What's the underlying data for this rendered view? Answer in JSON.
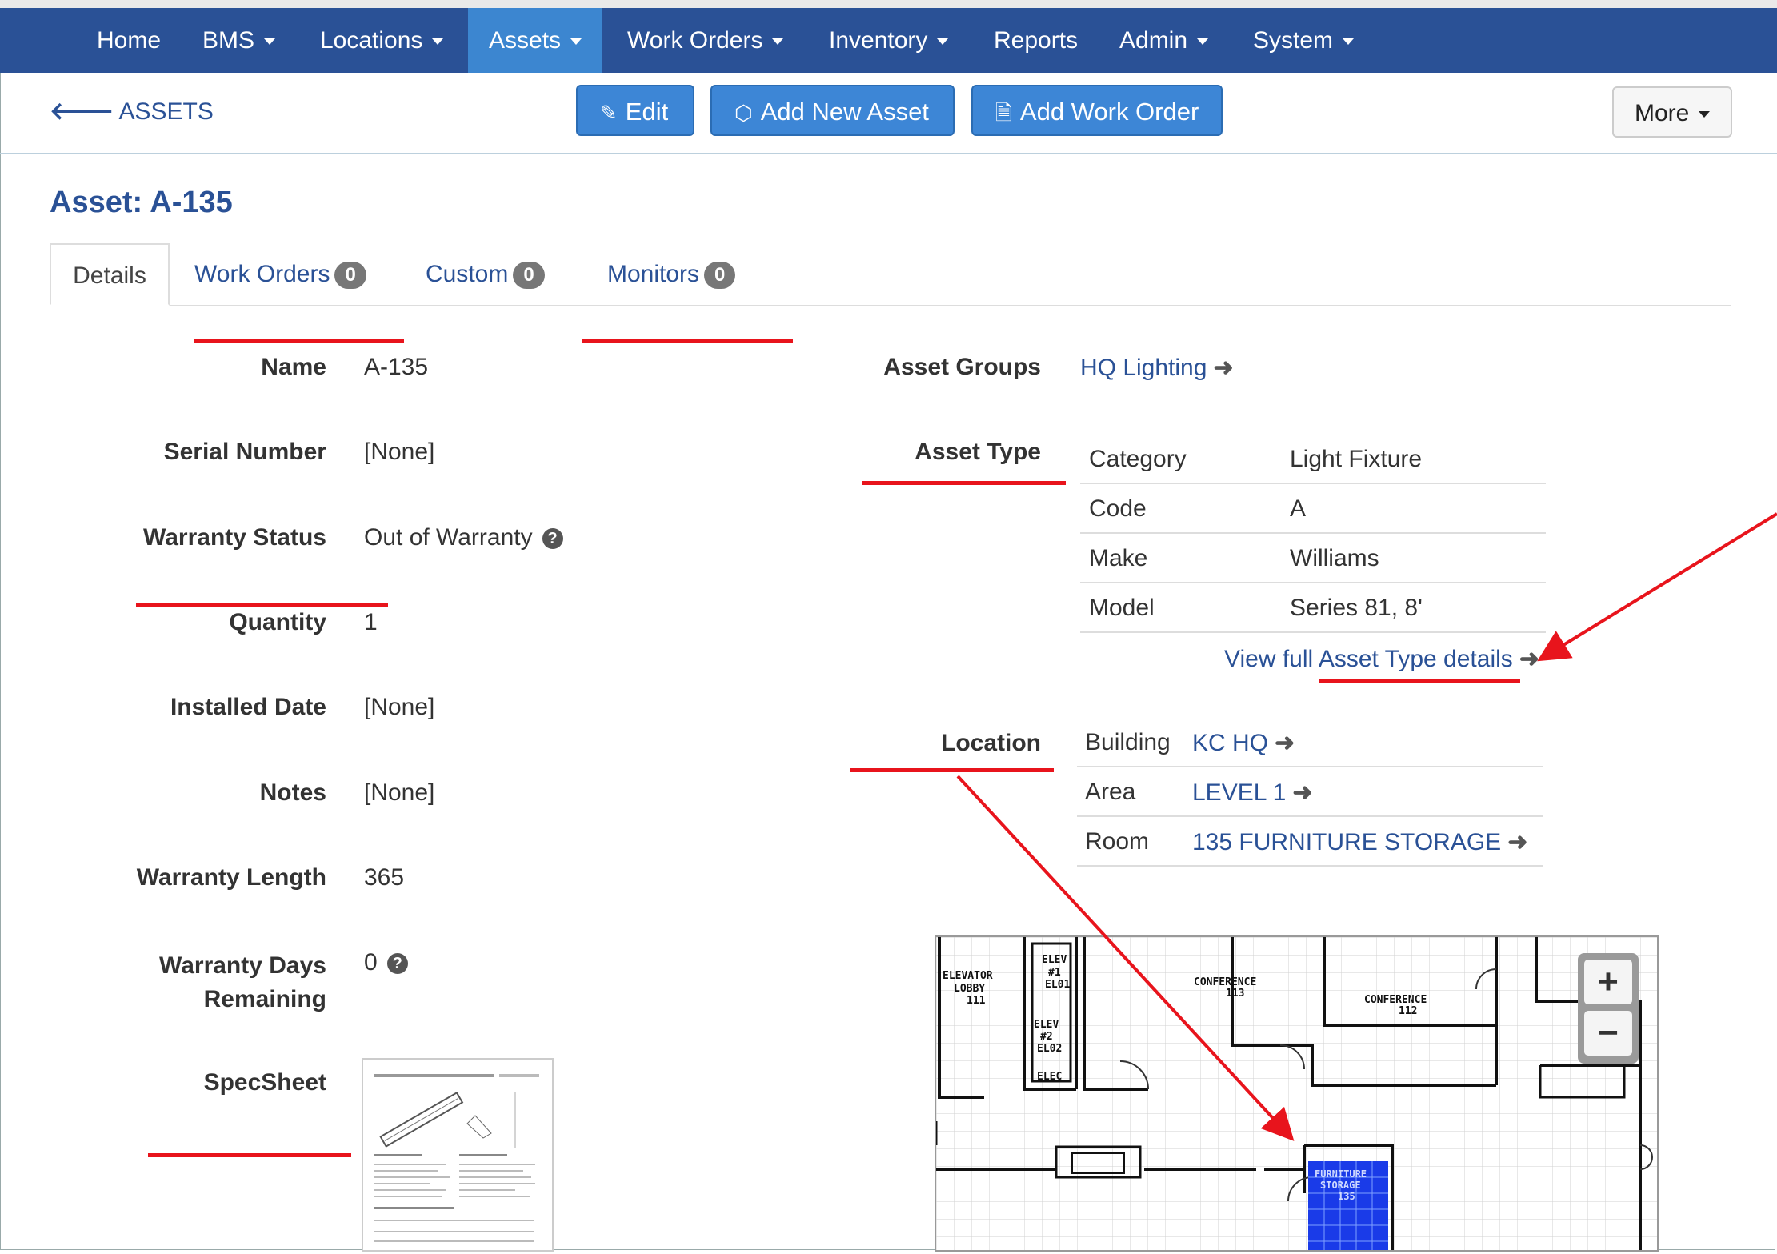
{
  "nav": {
    "items": [
      {
        "label": "Home",
        "dropdown": false
      },
      {
        "label": "BMS",
        "dropdown": true
      },
      {
        "label": "Locations",
        "dropdown": true
      },
      {
        "label": "Assets",
        "dropdown": true,
        "active": true
      },
      {
        "label": "Work Orders",
        "dropdown": true
      },
      {
        "label": "Inventory",
        "dropdown": true
      },
      {
        "label": "Reports",
        "dropdown": false
      },
      {
        "label": "Admin",
        "dropdown": true
      },
      {
        "label": "System",
        "dropdown": true
      }
    ]
  },
  "toolbar": {
    "back_label": "ASSETS",
    "edit_label": "Edit",
    "add_asset_label": "Add New Asset",
    "add_work_order_label": "Add Work Order",
    "more_label": "More"
  },
  "page": {
    "title": "Asset: A-135"
  },
  "tabs": [
    {
      "label": "Details",
      "badge": null
    },
    {
      "label": "Work Orders",
      "badge": "0"
    },
    {
      "label": "Custom",
      "badge": "0"
    },
    {
      "label": "Monitors",
      "badge": "0"
    }
  ],
  "details": {
    "name_label": "Name",
    "name": "A-135",
    "serial_label": "Serial Number",
    "serial": "[None]",
    "warranty_status_label": "Warranty Status",
    "warranty_status": "Out of Warranty",
    "quantity_label": "Quantity",
    "quantity": "1",
    "installed_label": "Installed Date",
    "installed": "[None]",
    "notes_label": "Notes",
    "notes": "[None]",
    "warranty_length_label": "Warranty Length",
    "warranty_length": "365",
    "warranty_days_label_1": "Warranty Days",
    "warranty_days_label_2": "Remaining",
    "warranty_days": "0",
    "specsheet_label": "SpecSheet"
  },
  "asset_groups": {
    "label": "Asset Groups",
    "value": "HQ Lighting"
  },
  "asset_type": {
    "label": "Asset Type",
    "rows": [
      {
        "key": "Category",
        "value": "Light Fixture"
      },
      {
        "key": "Code",
        "value": "A"
      },
      {
        "key": "Make",
        "value": "Williams"
      },
      {
        "key": "Model",
        "value": "Series 81, 8'"
      }
    ],
    "link_prefix": "View full",
    "link_text": "Asset Type details"
  },
  "location": {
    "label": "Location",
    "rows": [
      {
        "key": "Building",
        "value": "KC HQ"
      },
      {
        "key": "Area",
        "value": "LEVEL 1"
      },
      {
        "key": "Room",
        "value": "135 FURNITURE STORAGE"
      }
    ]
  },
  "map": {
    "zoom_in": "+",
    "zoom_out": "−",
    "labels": [
      "ELEVATOR",
      "LOBBY",
      "111",
      "ELEV",
      "#1",
      "EL01",
      "ELEV",
      "#2",
      "EL02",
      "ELEC",
      "CONFERENCE",
      "113",
      "CONFERENCE",
      "112",
      "FURNITURE",
      "STORAGE",
      "135"
    ]
  },
  "colors": {
    "navbar": "#2a5196",
    "active_nav": "#3c86d0",
    "button": "#3d86d6",
    "link": "#2a5196",
    "highlight": "#e8141c",
    "room": "#1a3be8"
  }
}
